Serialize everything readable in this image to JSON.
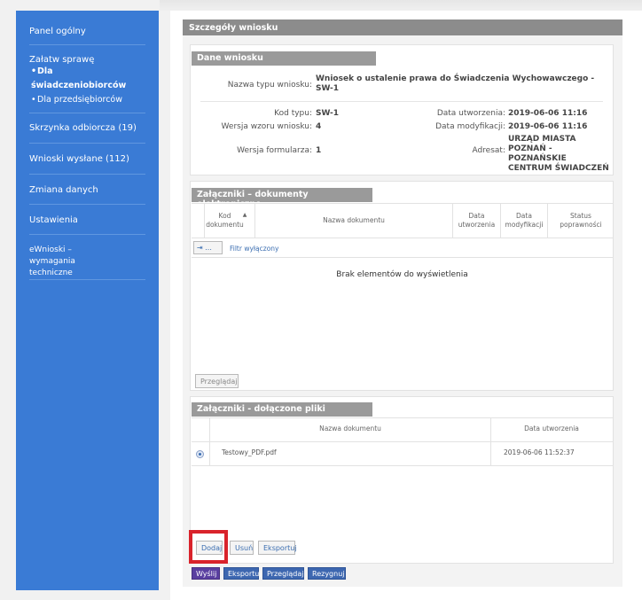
{
  "sidebar": {
    "items": [
      {
        "label": "Panel ogólny"
      },
      {
        "label": "Załatw sprawę"
      },
      {
        "label": "Skrzynka odbiorcza (19)"
      },
      {
        "label": "Wnioski wysłane (112)"
      },
      {
        "label": "Zmiana danych"
      },
      {
        "label": "Ustawienia"
      },
      {
        "label": "eWnioski – wymagania techniczne"
      }
    ],
    "sub": [
      {
        "label": "Dla świadczeniobiorców"
      },
      {
        "label": "Dla przedsiębiorców"
      }
    ],
    "bullet": "•"
  },
  "panel": {
    "title": "Szczegóły wniosku"
  },
  "dane": {
    "title": "Dane wniosku",
    "nazwa_label": "Nazwa typu wniosku:",
    "nazwa_value": "Wniosek o ustalenie prawa do Świadczenia Wychowawczego - SW-1",
    "kod_label": "Kod typu:",
    "kod_value": "SW-1",
    "wersja_wzoru_label": "Wersja wzoru wniosku:",
    "wersja_wzoru_value": "4",
    "wersja_form_label": "Wersja formularza:",
    "wersja_form_value": "1",
    "data_utw_label": "Data utworzenia:",
    "data_utw_value": "2019-06-06 11:16",
    "data_mod_label": "Data modyfikacji:",
    "data_mod_value": "2019-06-06 11:16",
    "adresat_label": "Adresat:",
    "adresat_value": "URZĄD MIASTA POZNAŃ - POZNAŃSKIE CENTRUM ŚWIADCZEŃ"
  },
  "elektroniczne": {
    "title": "Załączniki – dokumenty elektroniczne",
    "columns": [
      "Kod dokumentu",
      "Nazwa dokumentu",
      "Data utworzenia",
      "Data modyfikacji",
      "Status poprawności"
    ],
    "sort_arrow": "▲",
    "filter_icon": "⇥",
    "filter_dots": "...",
    "filter_text": "Filtr wyłączony",
    "empty": "Brak elementów do wyświetlenia",
    "browse": "Przeglądaj"
  },
  "pliki": {
    "title": "Załączniki - dołączone pliki",
    "columns": [
      "Nazwa dokumentu",
      "Data utworzenia"
    ],
    "rows": [
      {
        "name": "Testowy_PDF.pdf",
        "date": "2019-06-06 11:52:37"
      }
    ],
    "buttons": {
      "add": "Dodaj",
      "remove": "Usuń",
      "export": "Eksportuj"
    }
  },
  "footer": {
    "send": "Wyślij",
    "export": "Eksportuj",
    "browse": "Przeglądaj",
    "cancel": "Rezygnuj"
  },
  "colors": {
    "sidebar": "#3a7bd5",
    "header": "#8c8c8c",
    "highlight": "#d9232b"
  }
}
